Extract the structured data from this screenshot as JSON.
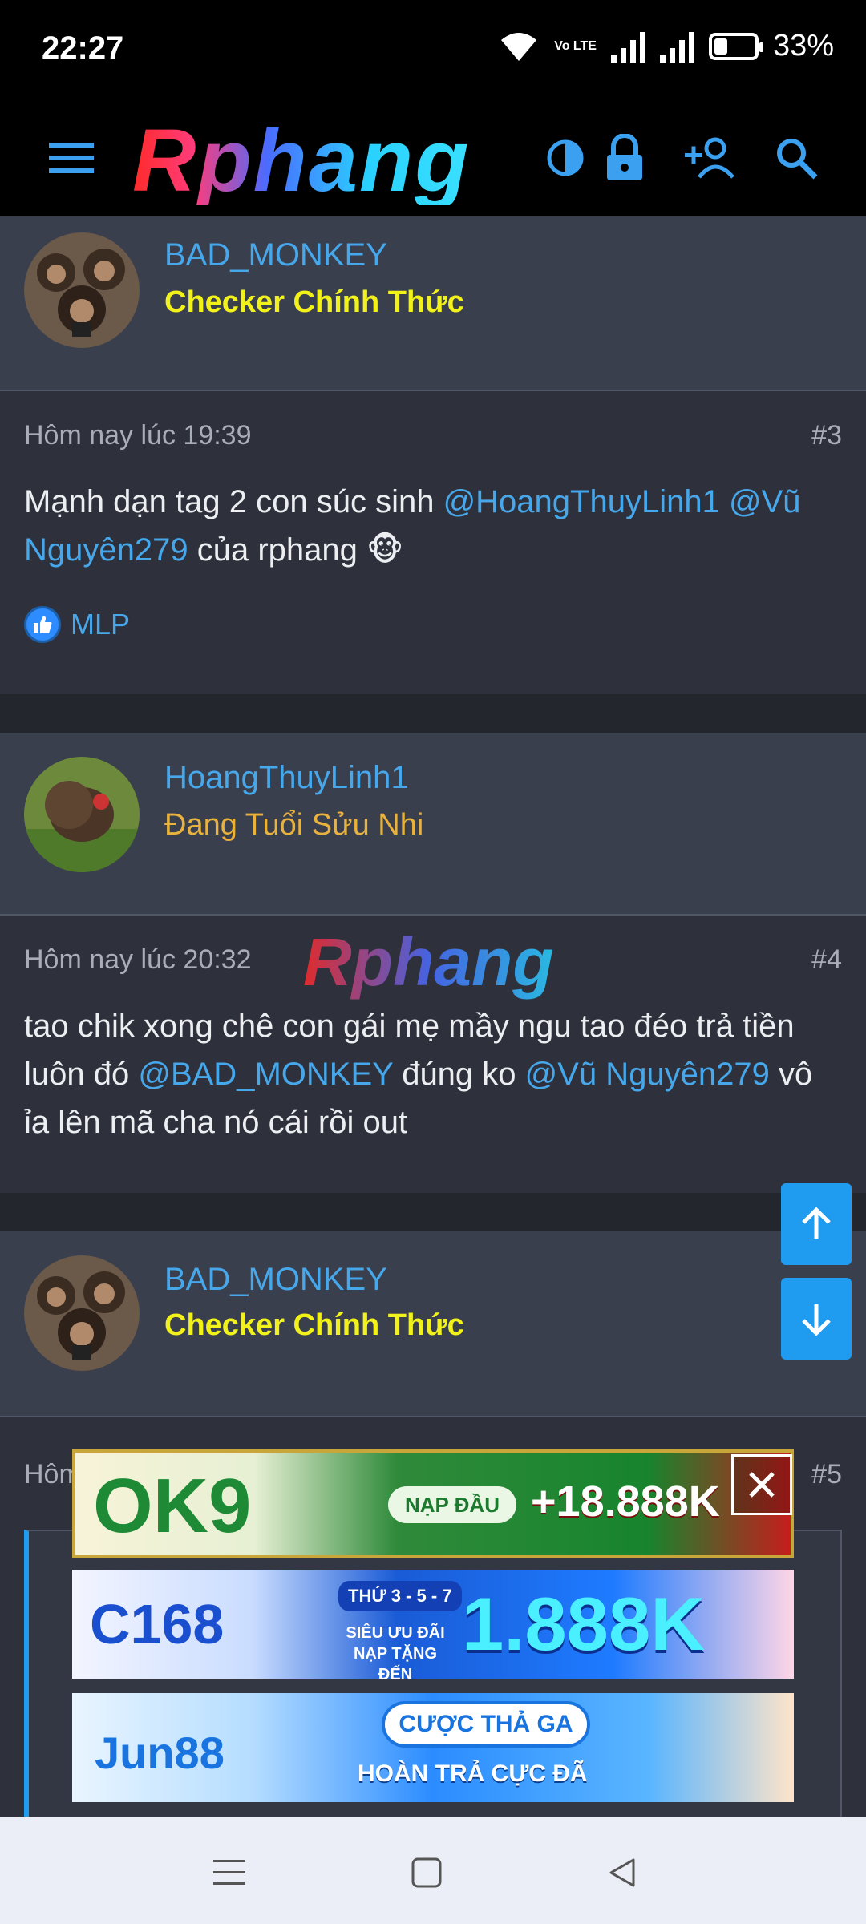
{
  "status": {
    "time": "22:27",
    "volte": "Vo LTE",
    "battery": "33%"
  },
  "header": {
    "logo": "Rphang"
  },
  "posts": [
    {
      "author": "BAD_MONKEY",
      "rank": "Checker Chính Thức",
      "time": "Hôm nay lúc 19:39",
      "number": "#3",
      "text_parts": [
        "Mạnh dạn tag 2 con súc sinh ",
        "@HoangThuyLinh1",
        " ",
        "@Vũ Nguyên279",
        " của rphang 🐵"
      ],
      "reaction_user": "MLP"
    },
    {
      "author": "HoangThuyLinh1",
      "rank": "Đang Tuổi Sửu Nhi",
      "time": "Hôm nay lúc 20:32",
      "number": "#4",
      "watermark": "Rphang",
      "text_parts": [
        "tao chik xong chê con gái mẹ mầy ngu tao đéo trả tiền luôn đó ",
        "@BAD_MONKEY",
        " đúng ko ",
        "@Vũ Nguyên279",
        " vô ỉa lên mã cha nó cái rồi out"
      ]
    },
    {
      "author": "BAD_MONKEY",
      "rank": "Checker Chính Thức",
      "time": "Hôm",
      "number": "#5"
    }
  ],
  "ads": [
    {
      "brand": "OK9",
      "cta": "NẠP ĐẦU",
      "amount": "+18.888K"
    },
    {
      "brand": "C168",
      "tag": "THỨ 3 - 5 - 7",
      "sub": "SIÊU ƯU ĐÃI NẠP TẶNG ĐẾN",
      "amount": "1.888K"
    },
    {
      "brand": "Jun88",
      "cta": "CƯỢC THẢ GA",
      "sub": "HOÀN TRẢ CỰC ĐÃ"
    }
  ],
  "icons": [
    "menu-icon",
    "contrast-icon",
    "lock-icon",
    "add-user-icon",
    "search-icon",
    "thumbs-up-icon",
    "arrow-up-icon",
    "arrow-down-icon",
    "close-icon",
    "nav-recents-icon",
    "nav-home-icon",
    "nav-back-icon"
  ],
  "colors": {
    "accent": "#47a7eb",
    "rank_yellow": "#f2f21a",
    "rank_orange": "#e8b23c",
    "fab": "#1f9bf0"
  }
}
